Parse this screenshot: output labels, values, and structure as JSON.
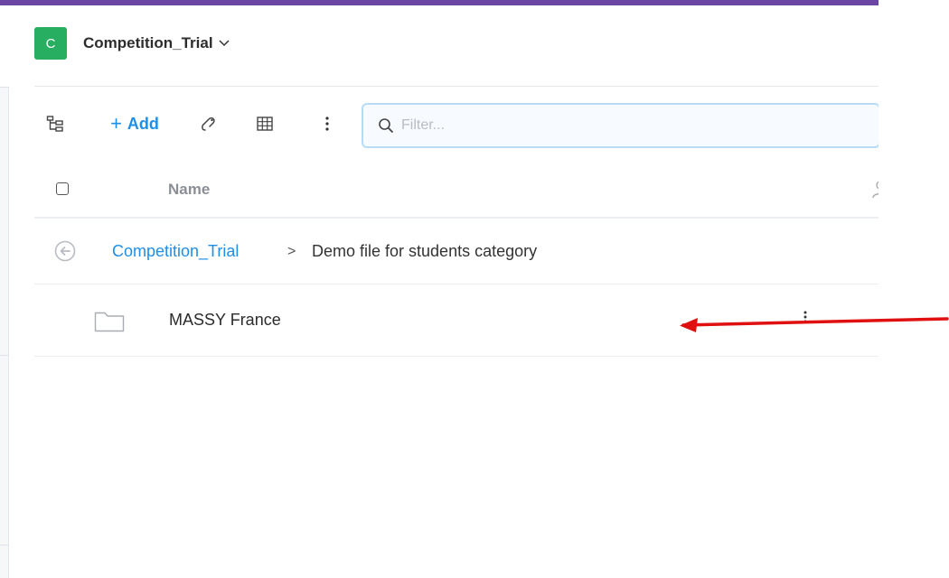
{
  "header": {
    "avatar_letter": "C",
    "project_title": "Competition_Trial"
  },
  "toolbar": {
    "add_label": "Add",
    "search": {
      "placeholder": "Filter...",
      "value": ""
    }
  },
  "table": {
    "columns": [
      "Name"
    ]
  },
  "breadcrumb": {
    "root": "Competition_Trial",
    "separator": ">",
    "current": "Demo file for students category"
  },
  "rows": [
    {
      "name": "MASSY France",
      "type": "folder"
    }
  ],
  "colors": {
    "accent": "#1e8fe8",
    "avatar": "#27ae60",
    "top_bar": "#6b46a3",
    "annotation_arrow": "#e01010"
  }
}
